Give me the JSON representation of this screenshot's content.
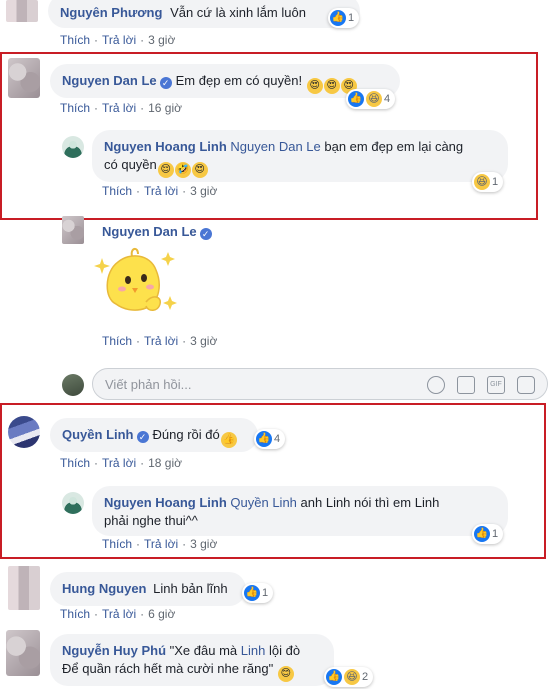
{
  "comments": [
    {
      "name": "Nguyên Phương",
      "text": "Vẫn cứ là xinh lắm luôn",
      "reactions": "1",
      "like": "Thích",
      "reply": "Trả lời",
      "time": "3 giờ"
    },
    {
      "name": "Nguyen Dan Le",
      "text": "Em đẹp em có quyền!",
      "reactions": "4",
      "like": "Thích",
      "reply": "Trả lời",
      "time": "16 giờ",
      "replies": [
        {
          "name": "Nguyen Hoang Linh",
          "tag": "Nguyen Dan Le",
          "text_line1": "bạn em đẹp em lại càng",
          "text_line2": "có quyền",
          "reactions": "1",
          "like": "Thích",
          "reply": "Trả lời",
          "time": "3 giờ"
        },
        {
          "name": "Nguyen Dan Le",
          "sticker": "chick-sticker",
          "like": "Thích",
          "reply": "Trả lời",
          "time": "3 giờ"
        }
      ]
    },
    {
      "name": "Quyền Linh",
      "text": "Đúng rồi đó",
      "reactions": "4",
      "like": "Thích",
      "reply": "Trả lời",
      "time": "18 giờ",
      "replies": [
        {
          "name": "Nguyen Hoang Linh",
          "tag": "Quyền Linh",
          "text_line1": "anh Linh nói thì em Linh",
          "text_line2": "phải nghe thui^^",
          "reactions": "1",
          "like": "Thích",
          "reply": "Trả lời",
          "time": "3 giờ"
        }
      ]
    },
    {
      "name": "Hung Nguyen",
      "text": "Linh bản lĩnh",
      "reactions": "1",
      "like": "Thích",
      "reply": "Trả lời",
      "time": "6 giờ"
    },
    {
      "name": "Nguyễn Huy Phú",
      "text_line1": "\"Xe đâu mà",
      "tag": "Linh",
      "text_line1b": "lội đò",
      "text_line2": "Để quần rách hết mà cười nhe răng\"",
      "reactions": "2"
    }
  ],
  "reply_box": {
    "placeholder": "Viết phản hồi...",
    "icons": [
      "emoji-icon",
      "camera-icon",
      "gif-icon",
      "sticker-icon"
    ]
  },
  "colors": {
    "link": "#385898",
    "highlight_box": "#c81d25",
    "bubble": "#f2f3f5",
    "like_blue": "#1877f2"
  }
}
